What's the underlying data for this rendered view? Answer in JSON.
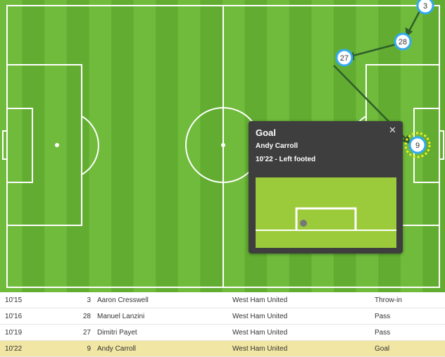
{
  "pitch": {
    "colors": {
      "stripe_light": "#70ba3c",
      "stripe_dark": "#62ad31",
      "lines": "#ffffff",
      "marker_fill": "#ffffff",
      "marker_ring": "#33aaee",
      "pass_line": "#2f5f2a",
      "goal_ring": "#eeee22"
    },
    "markers": [
      {
        "number": "3",
        "player": "Aaron Cresswell"
      },
      {
        "number": "28",
        "player": "Manuel Lanzini"
      },
      {
        "number": "27",
        "player": "Dimitri Payet"
      },
      {
        "number": "9",
        "player": "Andy Carroll",
        "highlighted": true
      }
    ]
  },
  "popup": {
    "title": "Goal",
    "player": "Andy Carroll",
    "detail": "10'22 - Left footed",
    "close_icon": "close-icon",
    "colors": {
      "background": "#3e3e3e",
      "goal_area": "#9bcb3a",
      "ball": "#777777"
    }
  },
  "events": [
    {
      "time": "10'15",
      "number": "3",
      "player": "Aaron Cresswell",
      "team": "West Ham United",
      "type": "Throw-in",
      "highlighted": false
    },
    {
      "time": "10'16",
      "number": "28",
      "player": "Manuel Lanzini",
      "team": "West Ham United",
      "type": "Pass",
      "highlighted": false
    },
    {
      "time": "10'19",
      "number": "27",
      "player": "Dimitri Payet",
      "team": "West Ham United",
      "type": "Pass",
      "highlighted": false
    },
    {
      "time": "10'22",
      "number": "9",
      "player": "Andy Carroll",
      "team": "West Ham United",
      "type": "Goal",
      "highlighted": true
    }
  ]
}
